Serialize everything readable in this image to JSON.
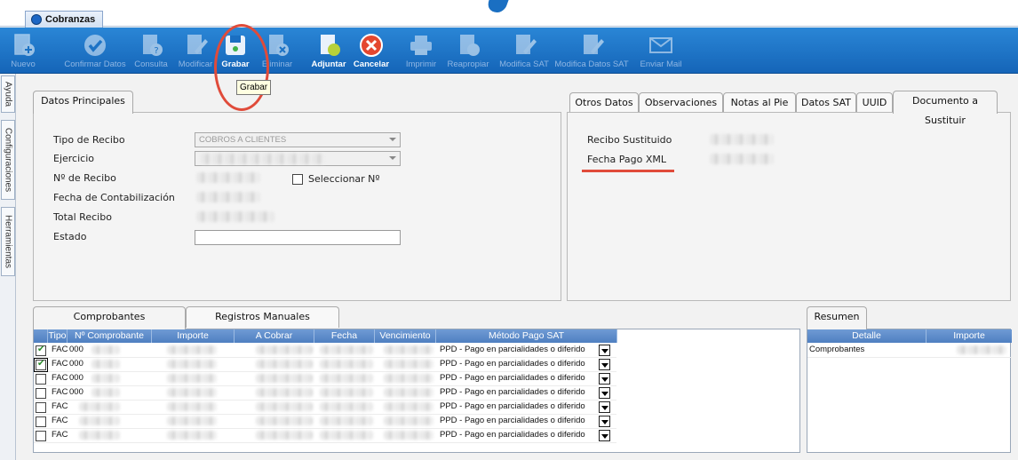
{
  "window": {
    "tab_title": "Cobranzas"
  },
  "toolbar": {
    "buttons": [
      {
        "id": "nuevo",
        "label": "Nuevo",
        "icon": "new-doc-icon",
        "enabled": false
      },
      {
        "id": "confirmar",
        "label": "Confirmar Datos",
        "icon": "checkmark-icon",
        "enabled": false
      },
      {
        "id": "consulta",
        "label": "Consulta",
        "icon": "query-doc-icon",
        "enabled": false
      },
      {
        "id": "modificar",
        "label": "Modificar",
        "icon": "edit-doc-icon",
        "enabled": false
      },
      {
        "id": "grabar",
        "label": "Grabar",
        "icon": "save-disk-icon",
        "enabled": true
      },
      {
        "id": "eliminar",
        "label": "Eliminar",
        "icon": "delete-doc-icon",
        "enabled": false
      },
      {
        "id": "adjuntar",
        "label": "Adjuntar",
        "icon": "attach-doc-icon",
        "enabled": true
      },
      {
        "id": "cancelar",
        "label": "Cancelar",
        "icon": "cancel-icon",
        "enabled": true
      },
      {
        "id": "imprimir",
        "label": "Imprimir",
        "icon": "printer-icon",
        "enabled": false
      },
      {
        "id": "reapropiar",
        "label": "Reapropiar",
        "icon": "reassign-doc-icon",
        "enabled": false
      },
      {
        "id": "modsat",
        "label": "Modifica SAT",
        "icon": "edit-sat-icon",
        "enabled": false
      },
      {
        "id": "moddatossat",
        "label": "Modifica Datos SAT",
        "icon": "edit-sat-data-icon",
        "enabled": false
      },
      {
        "id": "mail",
        "label": "Enviar Mail",
        "icon": "mail-icon",
        "enabled": false
      }
    ],
    "tooltip": "Grabar"
  },
  "side_tabs": [
    "Ayuda",
    "Configuraciones",
    "Herramientas"
  ],
  "main_panel": {
    "tab": "Datos Principales",
    "fields": {
      "tipo_recibo_label": "Tipo de Recibo",
      "tipo_recibo_value": "COBROS A CLIENTES",
      "ejercicio_label": "Ejercicio",
      "nro_recibo_label": "Nº de Recibo",
      "seleccionar_label": "Seleccionar Nº",
      "fecha_contab_label": "Fecha de Contabilización",
      "total_label": "Total Recibo",
      "estado_label": "Estado",
      "estado_value": ""
    }
  },
  "right_panel": {
    "tabs": [
      "Otros Datos",
      "Observaciones",
      "Notas al Pie",
      "Datos SAT",
      "UUID",
      "Documento a Sustituir"
    ],
    "active_tab": "Documento a Sustituir",
    "fields": {
      "recibo_sustituido_label": "Recibo Sustituido",
      "fecha_pago_xml_label": "Fecha Pago XML"
    }
  },
  "bottom": {
    "tabs": [
      "Comprobantes",
      "Registros Manuales"
    ],
    "columns": [
      "Tipo",
      "Nº Comprobante",
      "Importe",
      "A Cobrar",
      "Fecha",
      "Vencimiento",
      "Método Pago SAT"
    ],
    "rows": [
      {
        "checked": true,
        "tipo": "FAC",
        "comp_prefix": "000",
        "metodo": "PPD - Pago en parcialidades o diferido"
      },
      {
        "checked": true,
        "tipo": "FAC",
        "comp_prefix": "000",
        "metodo": "PPD - Pago en parcialidades o diferido"
      },
      {
        "checked": false,
        "tipo": "FAC",
        "comp_prefix": "000",
        "metodo": "PPD - Pago en parcialidades o diferido"
      },
      {
        "checked": false,
        "tipo": "FAC",
        "comp_prefix": "000",
        "metodo": "PPD - Pago en parcialidades o diferido"
      },
      {
        "checked": false,
        "tipo": "FAC",
        "comp_prefix": "",
        "metodo": "PPD - Pago en parcialidades o diferido"
      },
      {
        "checked": false,
        "tipo": "FAC",
        "comp_prefix": "",
        "metodo": "PPD - Pago en parcialidades o diferido"
      },
      {
        "checked": false,
        "tipo": "FAC",
        "comp_prefix": "",
        "metodo": "PPD - Pago en parcialidades o diferido"
      }
    ]
  },
  "resumen": {
    "tab": "Resumen",
    "columns": [
      "Detalle",
      "Importe"
    ],
    "rows": [
      {
        "detalle": "Comprobantes"
      }
    ]
  },
  "colors": {
    "toolbar": "#1a6fc2",
    "highlight": "#e04b3a",
    "grid_header": "#5a87c6"
  }
}
